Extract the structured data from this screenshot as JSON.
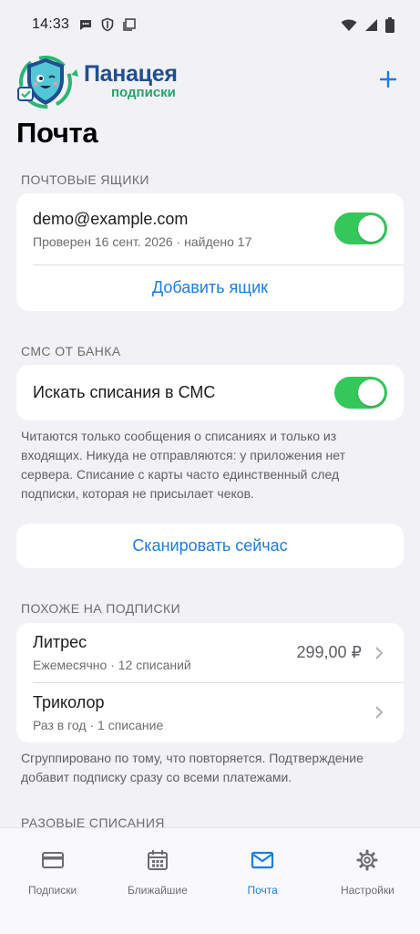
{
  "status_bar": {
    "time": "14:33"
  },
  "header": {
    "logo_title": "Панацея",
    "logo_subtitle": "подписки",
    "add_icon": "plus-icon"
  },
  "page_title": "Почта",
  "mailboxes": {
    "section_label": "ПОЧТОВЫЕ ЯЩИКИ",
    "account": {
      "email": "demo@example.com",
      "status": "Проверен 16 сент. 2026 · найдено 17",
      "enabled": true
    },
    "add_label": "Добавить ящик"
  },
  "sms": {
    "section_label": "СМС ОТ БАНКА",
    "toggle_label": "Искать списания в СМС",
    "enabled": true,
    "note": "Читаются только сообщения о списаниях и только из входящих. Никуда не отправляются: у приложения нет сервера. Списание с карты часто единственный след подписки, которая не присылает чеков."
  },
  "scan_label": "Сканировать сейчас",
  "similar": {
    "section_label": "ПОХОЖЕ НА ПОДПИСКИ",
    "items": [
      {
        "name": "Литрес",
        "details": "Ежемесячно · 12 списаний",
        "price": "299,00 ₽"
      },
      {
        "name": "Триколор",
        "details": "Раз в год · 1 списание",
        "price": ""
      }
    ],
    "note": "Сгруппировано по тому, что повторяется. Подтверждение добавит подписку сразу со всеми платежами."
  },
  "one_time": {
    "section_label": "РАЗОВЫЕ СПИСАНИЯ"
  },
  "tabs": [
    {
      "label": "Подписки",
      "icon": "card-icon",
      "active": false
    },
    {
      "label": "Ближайшие",
      "icon": "calendar-icon",
      "active": false
    },
    {
      "label": "Почта",
      "icon": "mail-icon",
      "active": true
    },
    {
      "label": "Настройки",
      "icon": "gear-icon",
      "active": false
    }
  ],
  "colors": {
    "accent": "#1a7de0",
    "toggle_on": "#34c759",
    "background": "#f2f2f6",
    "logo_blue": "#1e4f8f",
    "logo_green": "#22a56a"
  }
}
